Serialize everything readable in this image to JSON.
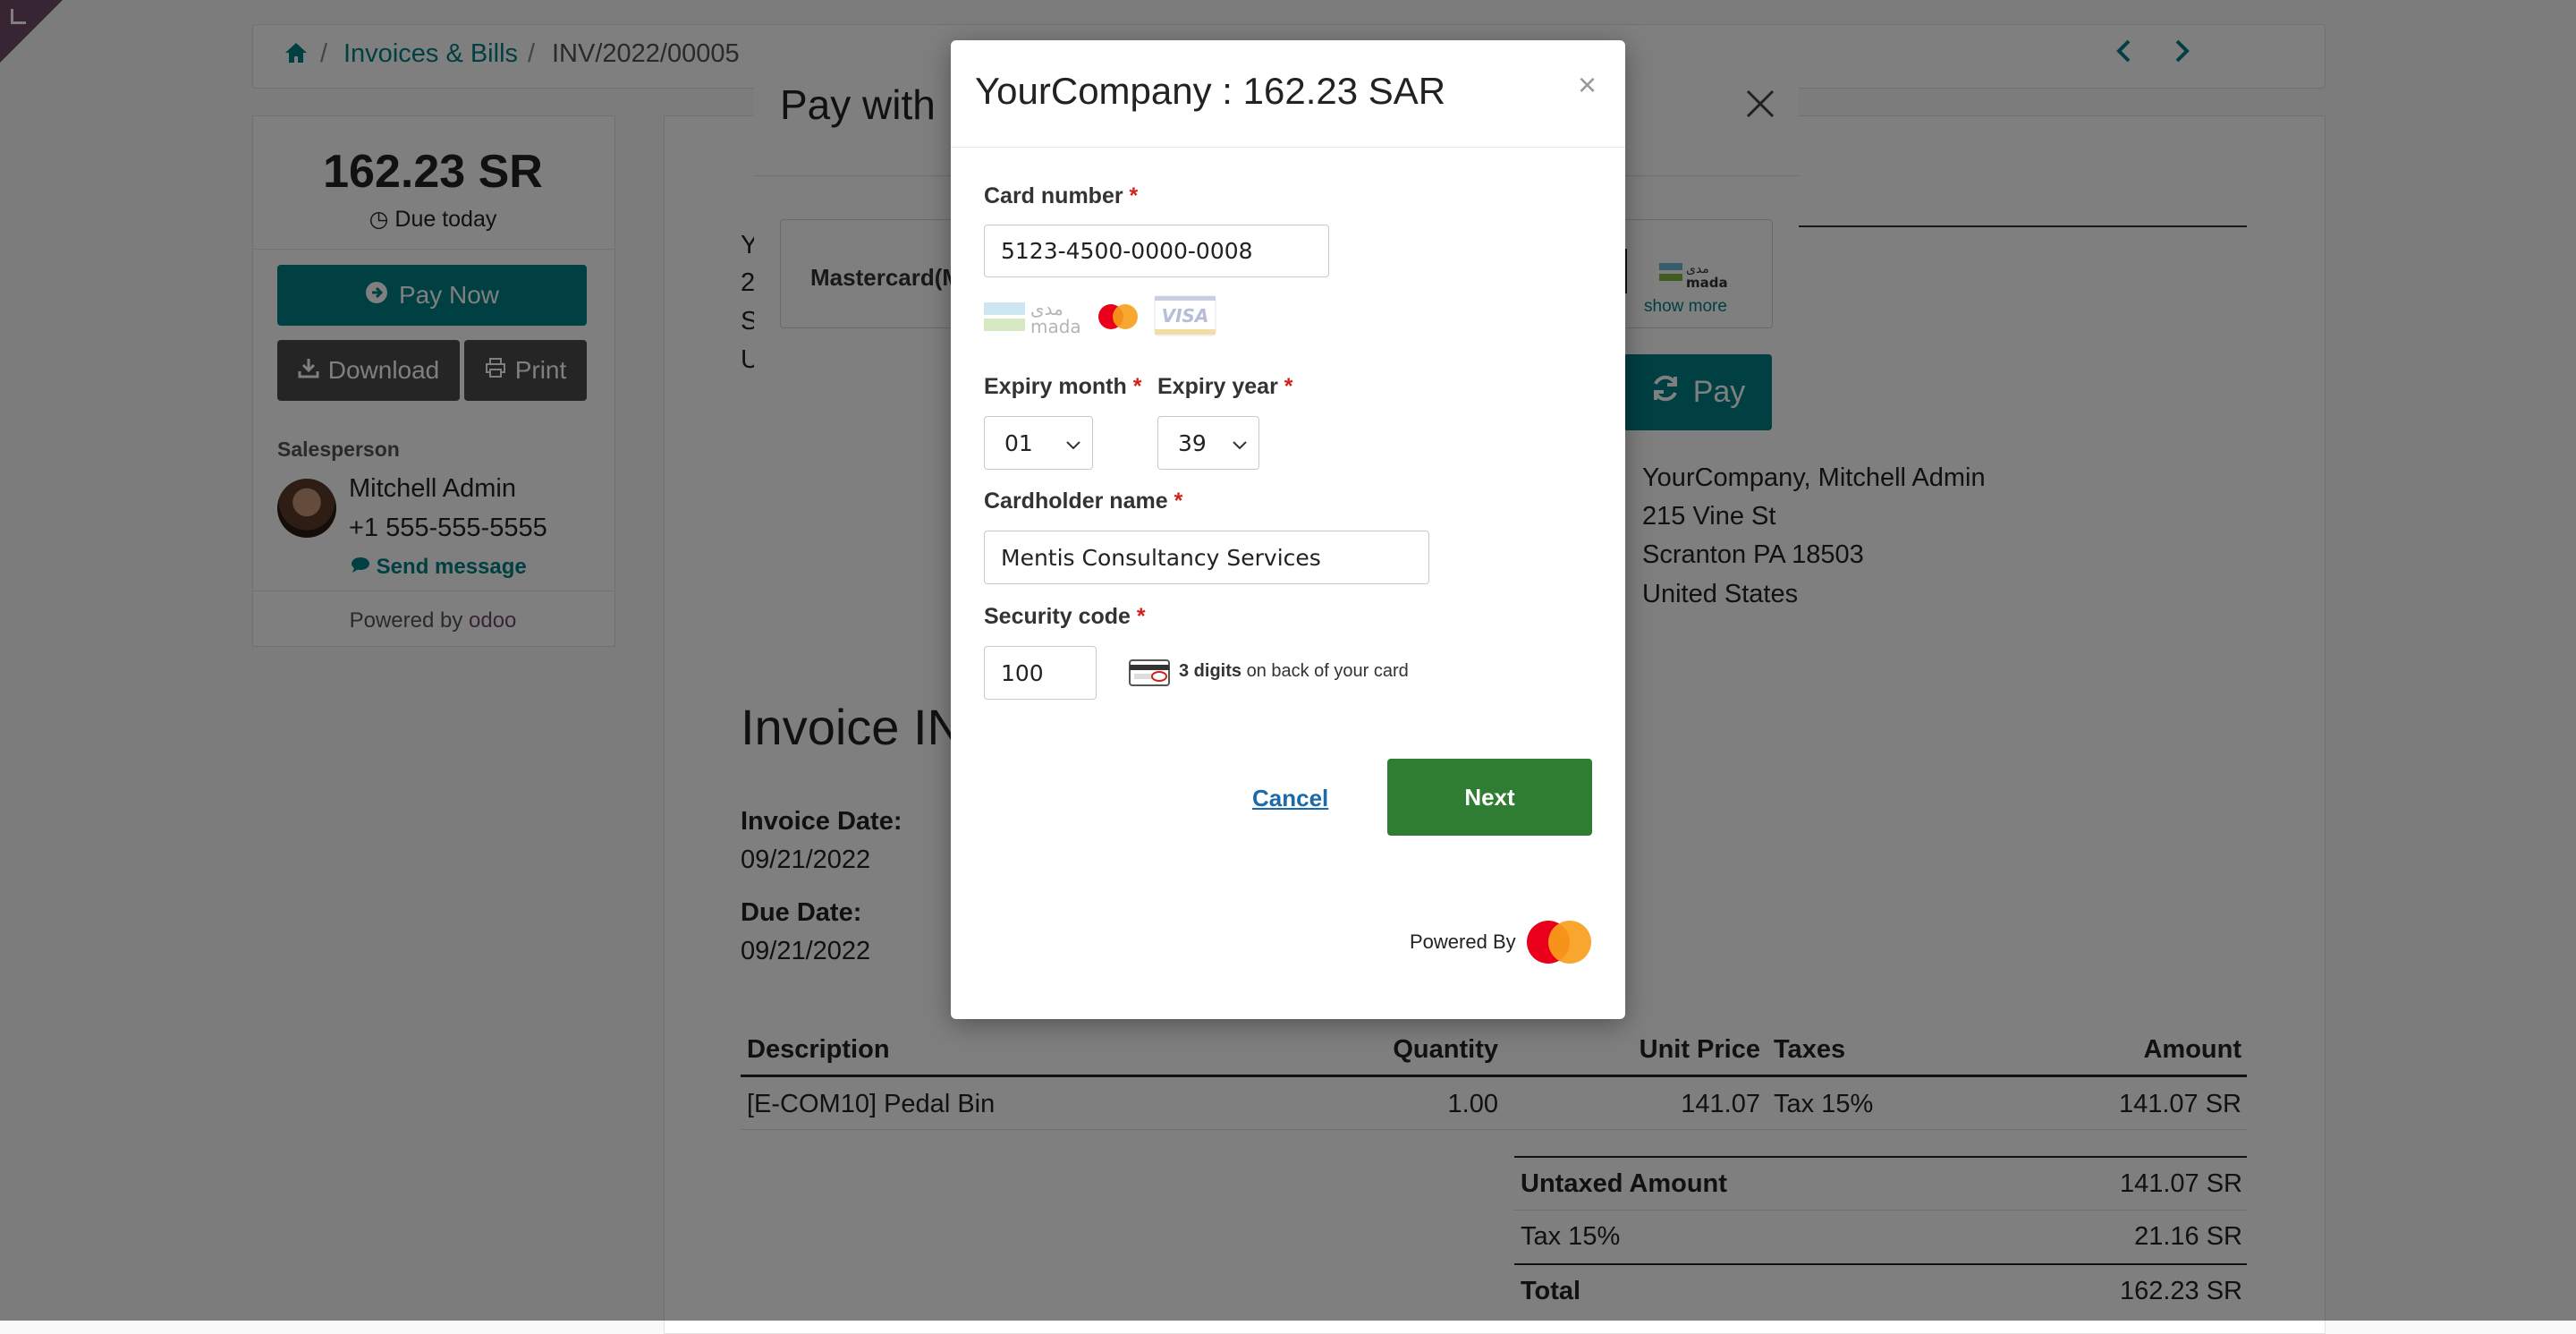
{
  "breadcrumb": {
    "home_icon": "home-icon",
    "items": [
      "Invoices & Bills",
      "INV/2022/00005"
    ],
    "separator": "/"
  },
  "sidebar": {
    "amount": "162.23 SR",
    "due_label": "Due today",
    "pay_now_label": "Pay Now",
    "download_label": "Download",
    "print_label": "Print",
    "salesperson_heading": "Salesperson",
    "salesperson_name": "Mitchell Admin",
    "salesperson_phone": "+1 555-555-5555",
    "send_message_label": "Send message",
    "powered_by": "Powered by",
    "powered_brand": "odoo"
  },
  "document": {
    "partial_left_lines": [
      "Y",
      "2",
      "S",
      "U"
    ],
    "address": [
      "YourCompany, Mitchell Admin",
      "215 Vine St",
      "Scranton PA 18503",
      "United States"
    ],
    "invoice_title_partial": "Invoice IN",
    "invoice_date_label": "Invoice Date:",
    "invoice_date": "09/21/2022",
    "due_date_label": "Due Date:",
    "due_date": "09/21/2022",
    "table": {
      "headers": [
        "Description",
        "Quantity",
        "Unit Price",
        "Taxes",
        "Amount"
      ],
      "rows": [
        [
          "[E-COM10] Pedal Bin",
          "1.00",
          "141.07",
          "Tax 15%",
          "141.07 SR"
        ]
      ]
    },
    "totals": [
      {
        "label": "Untaxed Amount",
        "value": "141.07 SR"
      },
      {
        "label": "Tax 15%",
        "value": "21.16 SR"
      },
      {
        "label": "Total",
        "value": "162.23 SR"
      }
    ]
  },
  "pay_modal": {
    "title_partial": "Pay with",
    "method_partial": "Mastercard(M",
    "show_more": "show more",
    "pay_label": "Pay"
  },
  "card_modal": {
    "title": "YourCompany : 162.23 SAR",
    "close_glyph": "×",
    "card_number_label": "Card number",
    "card_number_value": "5123-4500-0000-0008",
    "accepted_cards": [
      "mada",
      "mastercard",
      "visa"
    ],
    "expiry_month_label": "Expiry month",
    "expiry_month_value": "01",
    "expiry_year_label": "Expiry year",
    "expiry_year_value": "39",
    "cardholder_label": "Cardholder name",
    "cardholder_value": "Mentis Consultancy Services",
    "security_code_label": "Security code",
    "security_code_value": "100",
    "security_hint_bold": "3 digits",
    "security_hint_rest": "on back of your card",
    "required_mark": "*",
    "cancel_label": "Cancel",
    "next_label": "Next",
    "powered_by_label": "Powered By"
  },
  "colors": {
    "accent": "#017e84",
    "next_button": "#2e7d32",
    "required": "#d0211c",
    "ribbon": "#714B67"
  }
}
